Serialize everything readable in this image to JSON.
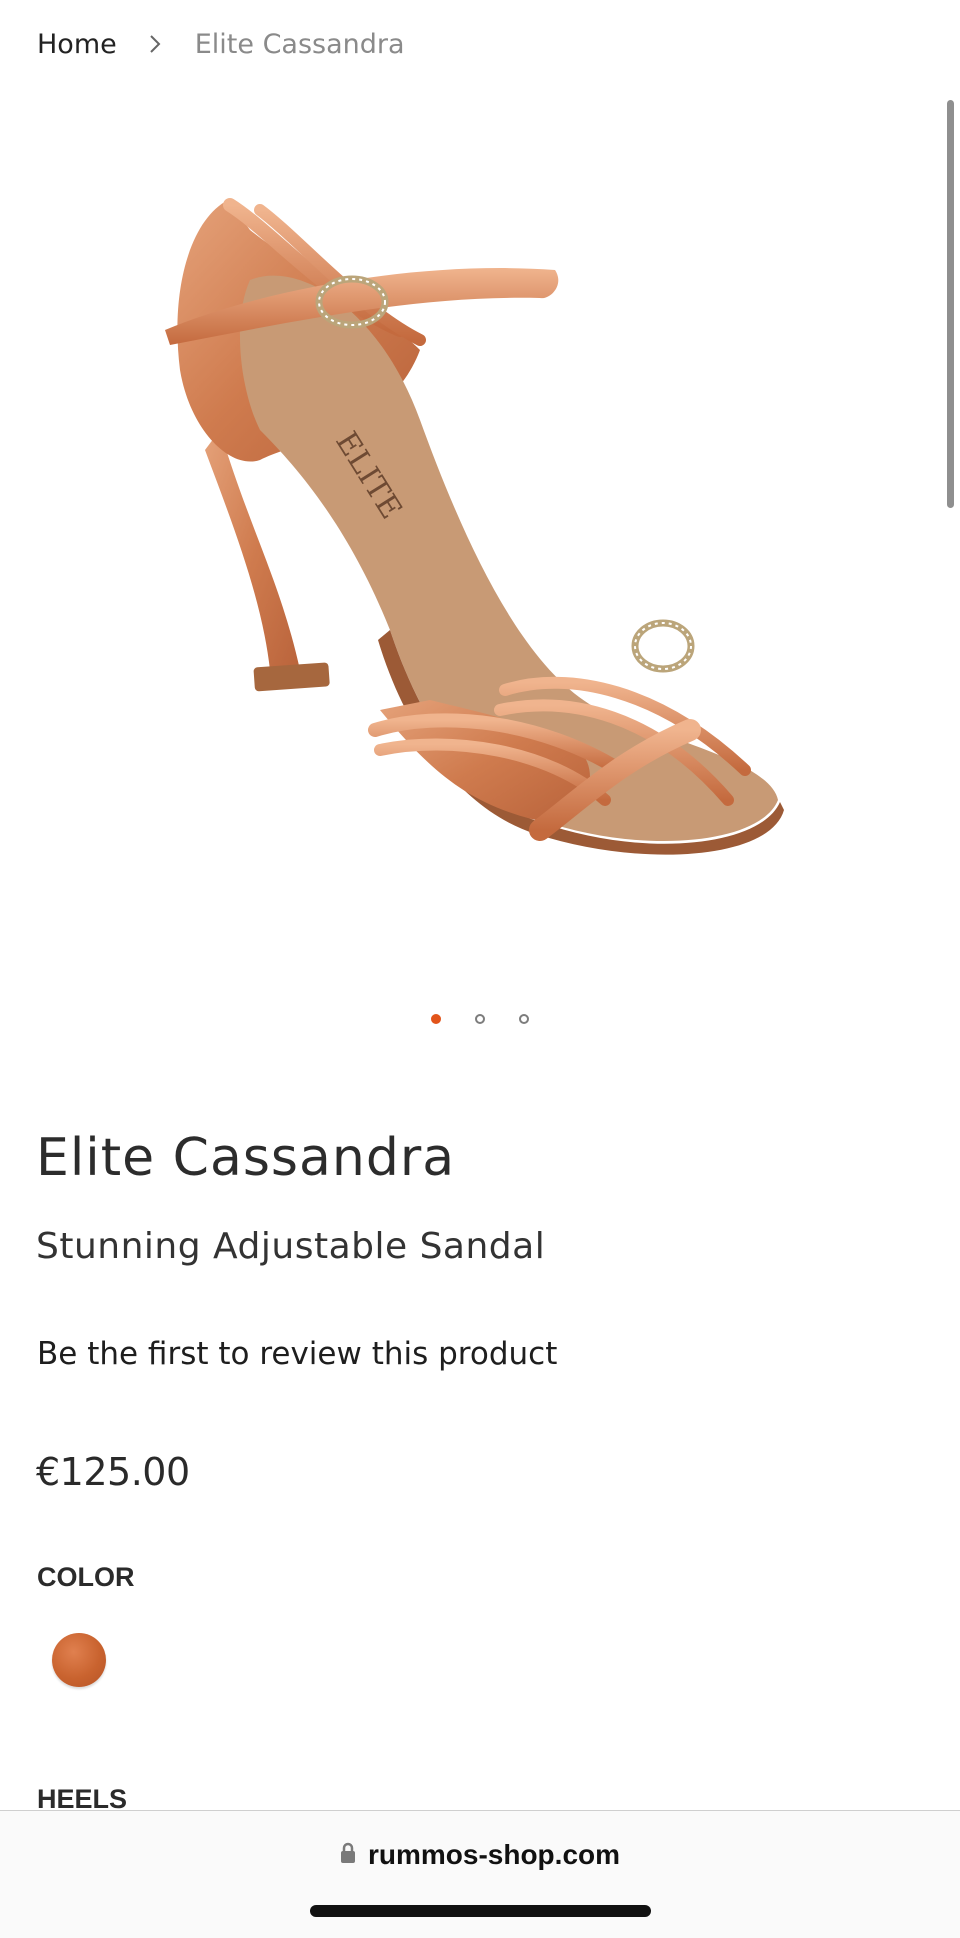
{
  "breadcrumb": {
    "home": "Home",
    "current": "Elite Cassandra"
  },
  "product": {
    "title": "Elite Cassandra",
    "subtitle": "Stunning Adjustable Sandal",
    "review_link": "Be the first to review this product",
    "price": "€125.00",
    "color_label": "COLOR",
    "color_swatch": "#c9632f",
    "heels_label": "HEELS"
  },
  "gallery": {
    "slide_count": 3,
    "active_index": 0,
    "image_icon": "dance-sandal-image",
    "insole_print": "ELITE"
  },
  "browser": {
    "url": "rummos-shop.com",
    "lock_icon": "lock-icon"
  },
  "colors": {
    "accent": "#e2541a",
    "shoe_satin": "#d98a5e",
    "insole": "#c99a76"
  }
}
